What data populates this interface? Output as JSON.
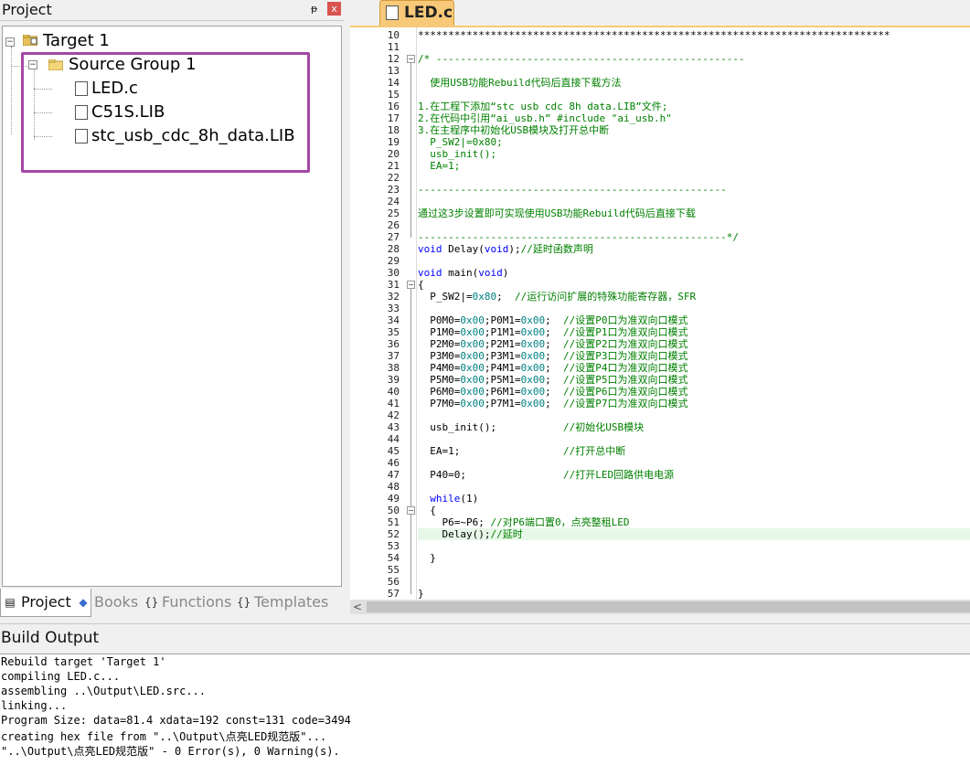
{
  "project_panel": {
    "title": "Project",
    "pin_glyph": "ᵽ",
    "close_glyph": "x",
    "tree": {
      "target": "Target 1",
      "group": "Source Group 1",
      "files": [
        "LED.c",
        "C51S.LIB",
        "stc_usb_cdc_8h_data.LIB"
      ]
    },
    "tabs": [
      {
        "label": "Project",
        "icon": "project-icon"
      },
      {
        "label": "Books",
        "icon": "books-icon"
      },
      {
        "label": "Functions",
        "icon": "functions-icon"
      },
      {
        "label": "Templates",
        "icon": "templates-icon"
      }
    ],
    "highlight_color": "#a347a6"
  },
  "editor": {
    "tab_label": "LED.c",
    "tab_color": "#f8c978",
    "current_line": 52,
    "lines": [
      {
        "n": 10,
        "t": "******************************************************************************"
      },
      {
        "n": 11,
        "t": ""
      },
      {
        "n": 12,
        "t": "/* ---------------------------------------------------"
      },
      {
        "n": 13,
        "t": ""
      },
      {
        "n": 14,
        "t": "  使用USB功能Rebuild代码后直接下载方法"
      },
      {
        "n": 15,
        "t": ""
      },
      {
        "n": 16,
        "t": "1.在工程下添加“stc usb cdc 8h data.LIB”文件;"
      },
      {
        "n": 17,
        "t": "2.在代码中引用“ai_usb.h” #include \"ai_usb.h\""
      },
      {
        "n": 18,
        "t": "3.在主程序中初始化USB模块及打开总中断"
      },
      {
        "n": 19,
        "t": "  P_SW2|=0x80;"
      },
      {
        "n": 20,
        "t": "  usb_init();"
      },
      {
        "n": 21,
        "t": "  EA=1;"
      },
      {
        "n": 22,
        "t": ""
      },
      {
        "n": 23,
        "t": "---------------------------------------------------"
      },
      {
        "n": 24,
        "t": ""
      },
      {
        "n": 25,
        "t": "通过这3步设置即可实现使用USB功能Rebuild代码后直接下载"
      },
      {
        "n": 26,
        "t": ""
      },
      {
        "n": 27,
        "t": "---------------------------------------------------*/"
      },
      {
        "n": 28,
        "t": "void Delay(void);//延时函数声明"
      },
      {
        "n": 29,
        "t": ""
      },
      {
        "n": 30,
        "t": "void main(void)"
      },
      {
        "n": 31,
        "t": "{"
      },
      {
        "n": 32,
        "t": "  P_SW2|=0x80;  //运行访问扩展的特殊功能寄存器，SFR"
      },
      {
        "n": 33,
        "t": ""
      },
      {
        "n": 34,
        "t": "  P0M0=0x00;P0M1=0x00;  //设置P0口为准双向口模式"
      },
      {
        "n": 35,
        "t": "  P1M0=0x00;P1M1=0x00;  //设置P1口为准双向口模式"
      },
      {
        "n": 36,
        "t": "  P2M0=0x00;P2M1=0x00;  //设置P2口为准双向口模式"
      },
      {
        "n": 37,
        "t": "  P3M0=0x00;P3M1=0x00;  //设置P3口为准双向口模式"
      },
      {
        "n": 38,
        "t": "  P4M0=0x00;P4M1=0x00;  //设置P4口为准双向口模式"
      },
      {
        "n": 39,
        "t": "  P5M0=0x00;P5M1=0x00;  //设置P5口为准双向口模式"
      },
      {
        "n": 40,
        "t": "  P6M0=0x00;P6M1=0x00;  //设置P6口为准双向口模式"
      },
      {
        "n": 41,
        "t": "  P7M0=0x00;P7M1=0x00;  //设置P7口为准双向口模式"
      },
      {
        "n": 42,
        "t": ""
      },
      {
        "n": 43,
        "t": "  usb_init();           //初始化USB模块"
      },
      {
        "n": 44,
        "t": ""
      },
      {
        "n": 45,
        "t": "  EA=1;                 //打开总中断"
      },
      {
        "n": 46,
        "t": ""
      },
      {
        "n": 47,
        "t": "  P40=0;                //打开LED回路供电电源"
      },
      {
        "n": 48,
        "t": ""
      },
      {
        "n": 49,
        "t": "  while(1)"
      },
      {
        "n": 50,
        "t": "  {"
      },
      {
        "n": 51,
        "t": "    P6=~P6; //对P6端口置0，点亮整租LED"
      },
      {
        "n": 52,
        "t": "    Delay();//延时"
      },
      {
        "n": 53,
        "t": ""
      },
      {
        "n": 54,
        "t": "  }"
      },
      {
        "n": 55,
        "t": ""
      },
      {
        "n": 56,
        "t": ""
      },
      {
        "n": 57,
        "t": "}"
      }
    ]
  },
  "build_output": {
    "title": "Build Output",
    "lines": [
      "Rebuild target 'Target 1'",
      "compiling LED.c...",
      "assembling ..\\Output\\LED.src...",
      "linking...",
      "Program Size: data=81.4 xdata=192 const=131 code=3494",
      "creating hex file from \"..\\Output\\点亮LED规范版\"...",
      "\"..\\Output\\点亮LED规范版\" - 0 Error(s), 0 Warning(s)."
    ]
  }
}
